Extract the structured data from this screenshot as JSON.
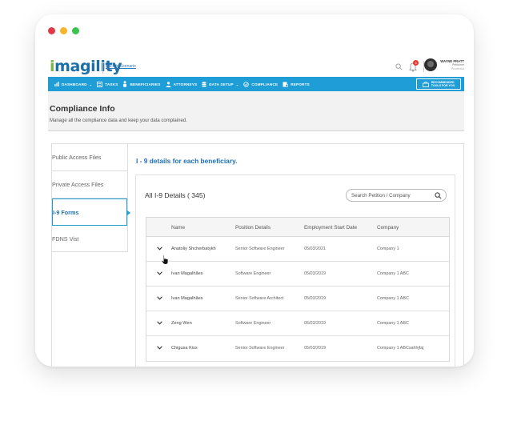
{
  "window_dots": [
    "#e03a4a",
    "#f6b52a",
    "#3ac34f"
  ],
  "logo": {
    "prefix": "i",
    "text": "magility"
  },
  "back_link": "Back to Scenario",
  "notification_count": "3",
  "user": {
    "name": "WAYNE PRATT",
    "role": "Petitioner",
    "company": "Prudential"
  },
  "nav": {
    "items": [
      {
        "label": "DASHBOARD",
        "icon": "bar-chart-icon",
        "has_dropdown": true
      },
      {
        "label": "TASKS",
        "icon": "tasks-icon",
        "has_dropdown": false
      },
      {
        "label": "BENEFICIARIES",
        "icon": "person-icon",
        "has_dropdown": false
      },
      {
        "label": "ATTORNEYS",
        "icon": "attorney-icon",
        "has_dropdown": false
      },
      {
        "label": "DATA SETUP",
        "icon": "database-icon",
        "has_dropdown": true
      },
      {
        "label": "COMPLIANCE",
        "icon": "compliance-icon",
        "has_dropdown": false
      },
      {
        "label": "REPORTS",
        "icon": "reports-icon",
        "has_dropdown": false
      }
    ],
    "reco_line1": "RECOMMENDED",
    "reco_line2": "TOOLS FOR YOU"
  },
  "page": {
    "title": "Compliance Info",
    "subtitle": "Manage all the compliance data and keep your data complained."
  },
  "sidebar": {
    "items": [
      {
        "label": "Public Access Files",
        "active": false
      },
      {
        "label": "Private Access Files",
        "active": false
      },
      {
        "label": "I-9 Forms",
        "active": true
      },
      {
        "label": "FDNS Vist",
        "active": false
      }
    ]
  },
  "panel": {
    "heading": "I - 9 details for each beneficiary.",
    "list_title": "All I-9 Details ( 345)",
    "search_placeholder": "Search Petition / Company"
  },
  "table": {
    "headers": [
      "Name",
      "Position Details",
      "Employment Start Date",
      "Company"
    ],
    "rows": [
      {
        "name": "Anatoliy Shcherbatykh",
        "position": "Senior Software Engineer",
        "start_date": "05/03/2021",
        "company": "Company 1"
      },
      {
        "name": "Ivan Magalhães",
        "position": "Software Engineer",
        "start_date": "05/03/2019",
        "company": "Company 1 ABC"
      },
      {
        "name": "Ivan Magalhães",
        "position": "Senior Software Architect",
        "start_date": "05/03/2019",
        "company": "Company 1 ABC"
      },
      {
        "name": "Zeng Wen",
        "position": "Software Engineer",
        "start_date": "05/03/2019",
        "company": "Company 1 ABC"
      },
      {
        "name": "Chigusa Kiss",
        "position": "Senior Software Engineer",
        "start_date": "05/03/2019",
        "company": "Company 1 ABCsahhjfaj"
      }
    ]
  },
  "colors": {
    "accent": "#1e9dd6",
    "link": "#1e6fb4",
    "logo_green": "#7ab648",
    "logo_blue": "#1d6fa8"
  }
}
